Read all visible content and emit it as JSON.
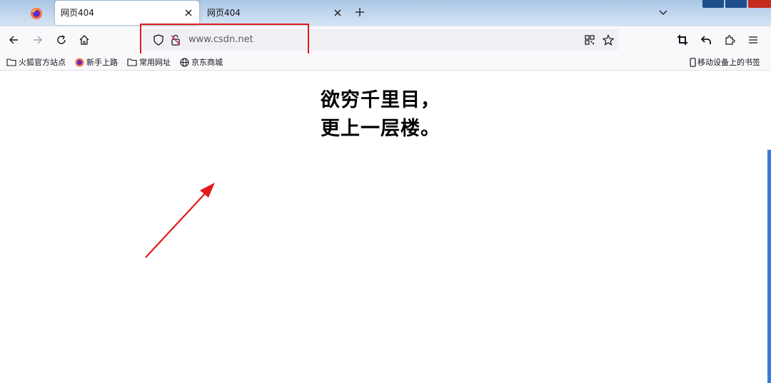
{
  "tabs": [
    {
      "title": "网页404",
      "active": true
    },
    {
      "title": "网页404",
      "active": false
    }
  ],
  "urlbar": {
    "url": "www.csdn.net",
    "highlight_color": "#e21a1a"
  },
  "bookmarks": [
    {
      "label": "火狐官方站点",
      "icon": "folder-icon"
    },
    {
      "label": "新手上路",
      "icon": "firefox-icon"
    },
    {
      "label": "常用网址",
      "icon": "folder-icon"
    },
    {
      "label": "京东商城",
      "icon": "globe-icon"
    }
  ],
  "mobile_bookmarks": {
    "label": "移动设备上的书签",
    "icon": "mobile-device-icon"
  },
  "page": {
    "poem_line1": "欲穷千里目，",
    "poem_line2": "更上一层楼。"
  },
  "annotation": {
    "type": "arrow",
    "color": "#e21a1a"
  },
  "colors": {
    "accent": "#1f4e8c",
    "close": "#c42b1c",
    "tabstrip": "#c3d8ee"
  }
}
